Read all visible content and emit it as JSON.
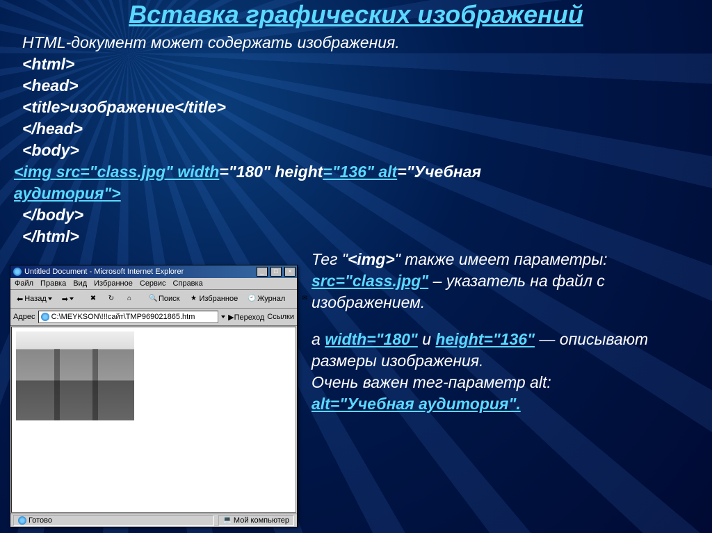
{
  "title": "Вставка графических изображений",
  "intro": "HTML-документ может содержать изображения.",
  "code": {
    "l1": "<html>",
    "l2": "<head>",
    "l3": "<title>изображение</title>",
    "l4": "</head>",
    "l5": "<body>",
    "l6a": "<img src=\"class.jpg\" width",
    "l6b": "=\"180\" height",
    "l6c": "=\"136\" alt",
    "l6d": "=\"Учебная",
    "l7": "аудитория\">",
    "l8": "</body>",
    "l9": "</html>"
  },
  "para1": {
    "t1": "Тег \"",
    "tag": "<img>",
    "t2": "\" также имеет параметры: ",
    "src": "src=\"class.jpg\"",
    "t3": " – указатель на файл с изображением."
  },
  "para2": {
    "t1": "а ",
    "w": "width=\"180\"",
    "t2": " и ",
    "h": "height=\"136\"",
    "t3": " — описывают размеры изображения."
  },
  "para3": {
    "t1": "Очень важен тег-параметр alt: ",
    "alt": "alt=\"Учебная аудитория\"."
  },
  "browser": {
    "title": "Untitled Document - Microsoft Internet Explorer",
    "menu": {
      "file": "Файл",
      "edit": "Правка",
      "view": "Вид",
      "fav": "Избранное",
      "tools": "Сервис",
      "help": "Справка"
    },
    "toolbar": {
      "back": "Назад",
      "search": "Поиск",
      "fav": "Избранное",
      "journal": "Журнал"
    },
    "addr_label": "Адрес",
    "addr_value": "C:\\MEYKSON\\!!!сайт\\TMP969021865.htm",
    "go": "Переход",
    "links": "Ссылки",
    "status_ready": "Готово",
    "status_comp": "Мой компьютер"
  }
}
